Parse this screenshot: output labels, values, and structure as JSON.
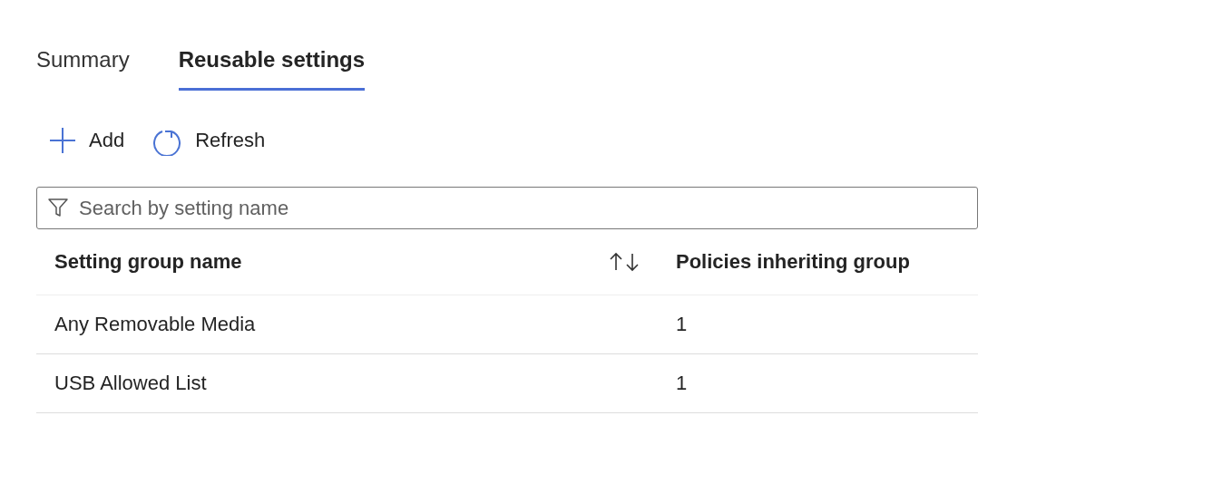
{
  "tabs": [
    {
      "label": "Summary",
      "selected": false
    },
    {
      "label": "Reusable settings",
      "selected": true
    }
  ],
  "toolbar": [
    {
      "kind": "add",
      "label": "Add"
    },
    {
      "kind": "refresh",
      "label": "Refresh"
    }
  ],
  "search": {
    "placeholder": "Search by setting name"
  },
  "table": {
    "columns": [
      {
        "label": "Setting group name",
        "sortable": true
      },
      {
        "label": "Policies inheriting group",
        "sortable": false
      }
    ],
    "rows": [
      [
        "Any Removable Media",
        "1"
      ],
      [
        "USB Allowed List",
        "1"
      ]
    ]
  }
}
